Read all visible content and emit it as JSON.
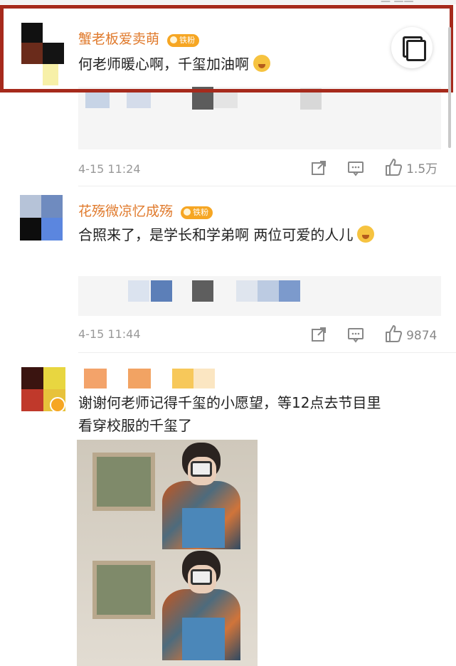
{
  "comments": [
    {
      "username": "蟹老板爱卖萌",
      "badge": "铁粉",
      "text": "何老师暖心啊，千玺加油啊",
      "emoji_icon": "sweat-smile-emoji",
      "time": "4-15 11:24",
      "likes": "1.5万"
    },
    {
      "username": "花殇微凉忆成殇",
      "badge": "铁粉",
      "text": "合照来了，是学长和学弟啊 两位可爱的人儿",
      "emoji_icon": "shy-emoji",
      "time": "4-15 11:44",
      "likes": "9874"
    },
    {
      "text_line1": "谢谢何老师记得千玺的小愿望，等12点去节目里",
      "text_line2": "看穿校服的千玺了"
    }
  ],
  "icons": {
    "share": "share-icon",
    "comment": "comment-icon",
    "like": "thumbs-up-icon",
    "copy": "copy-icon"
  },
  "colors": {
    "username": "#e07a2c",
    "badge": "#f6a623",
    "highlight_border": "#a62a1c",
    "meta_text": "#999999"
  }
}
